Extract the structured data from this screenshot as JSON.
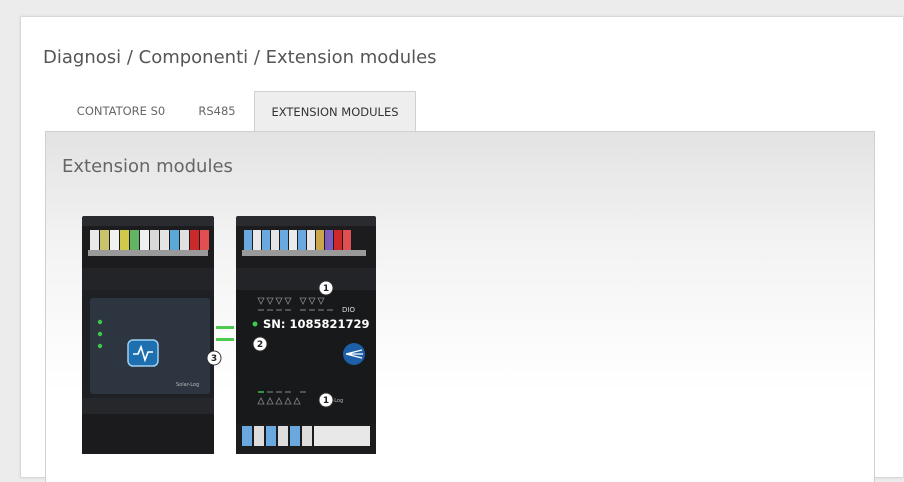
{
  "breadcrumb": "Diagnosi / Componenti / Extension modules",
  "tabs": [
    {
      "label": "CONTATORE S0",
      "active": false
    },
    {
      "label": "RS485",
      "active": false
    },
    {
      "label": "EXTENSION MODULES",
      "active": true
    }
  ],
  "panel": {
    "title": "Extension modules",
    "module": {
      "serial_label": "SN: 1085821729",
      "io_label": "DIO",
      "brand": "Solar-Log",
      "callouts": [
        "1",
        "2",
        "3",
        "1"
      ]
    }
  },
  "colors": {
    "accent_tab_bg": "#eeeeee",
    "module_body": "#1e1f22",
    "led_green": "#3fc94a",
    "connector_blue": "#6aa9e0"
  }
}
